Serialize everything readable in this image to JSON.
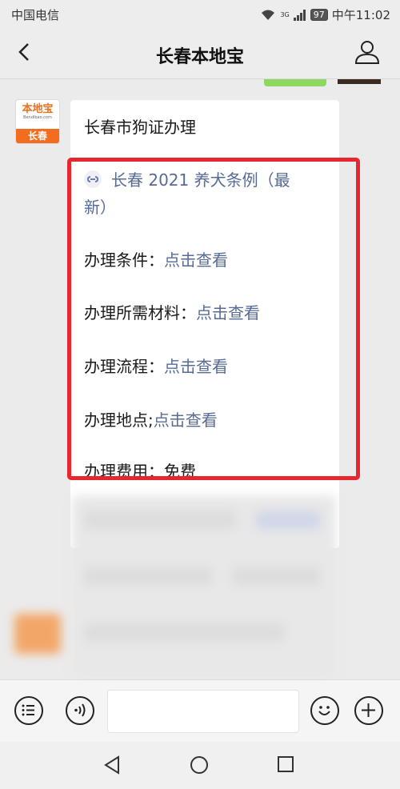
{
  "status_bar": {
    "carrier": "中国电信",
    "network": "3G",
    "battery": "97",
    "time": "中午11:02"
  },
  "nav": {
    "title": "长春本地宝",
    "back_icon": "chevron-left-icon",
    "profile_icon": "person-icon"
  },
  "message": {
    "avatar": {
      "logo_text": "本地宝",
      "logo_sub": "Bendibao.com",
      "city": "长春"
    },
    "title": "长春市狗证办理",
    "mini_program_icon": "mini-program-icon",
    "mini_program_line1": "长春 2021 养犬条例（最",
    "mini_program_line2": "新）",
    "items": [
      {
        "label": "办理条件：",
        "link": "点击查看"
      },
      {
        "label": "办理所需材料：",
        "link": "点击查看"
      },
      {
        "label": "办理流程：",
        "link": "点击查看"
      },
      {
        "label": "办理地点;",
        "link": "点击查看"
      },
      {
        "label": "办理费用：",
        "value": "免费"
      }
    ]
  },
  "input_bar": {
    "menu_icon": "menu-list-icon",
    "voice_icon": "voice-icon",
    "emoji_icon": "emoji-icon",
    "plus_icon": "plus-icon"
  },
  "system_nav": {
    "back_icon": "triangle-back-icon",
    "home_icon": "circle-home-icon",
    "recents_icon": "square-recents-icon"
  },
  "colors": {
    "link": "#576b95",
    "highlight_box": "#e8262f",
    "logo_orange": "#f26d1f"
  }
}
